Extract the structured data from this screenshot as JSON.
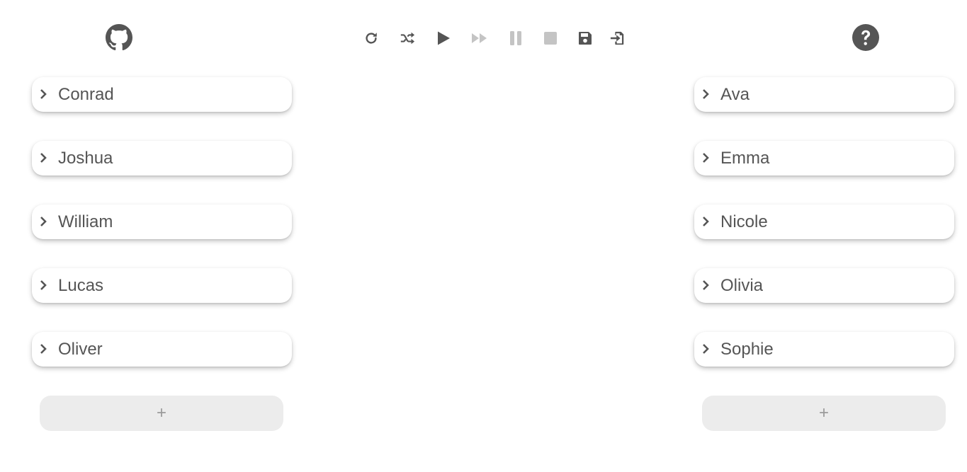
{
  "header": {
    "github_icon": "github-icon",
    "help_icon": "question-circle-icon"
  },
  "toolbar": {
    "buttons": [
      {
        "icon": "redo-icon",
        "state": "enabled"
      },
      {
        "icon": "shuffle-icon",
        "state": "enabled"
      },
      {
        "icon": "play-icon",
        "state": "enabled"
      },
      {
        "icon": "fast-forward-icon",
        "state": "disabled"
      },
      {
        "icon": "pause-icon",
        "state": "disabled"
      },
      {
        "icon": "stop-icon",
        "state": "disabled"
      },
      {
        "icon": "save-icon",
        "state": "enabled"
      },
      {
        "icon": "import-icon",
        "state": "enabled"
      }
    ]
  },
  "left_list": {
    "items": [
      {
        "label": "Conrad"
      },
      {
        "label": "Joshua"
      },
      {
        "label": "William"
      },
      {
        "label": "Lucas"
      },
      {
        "label": "Oliver"
      }
    ],
    "add_label": "+"
  },
  "right_list": {
    "items": [
      {
        "label": "Ava"
      },
      {
        "label": "Emma"
      },
      {
        "label": "Nicole"
      },
      {
        "label": "Olivia"
      },
      {
        "label": "Sophie"
      }
    ],
    "add_label": "+"
  },
  "colors": {
    "icon_enabled": "#555555",
    "icon_disabled": "#c4c4c4",
    "text": "#555555",
    "add_button_bg": "#ececec",
    "add_button_text": "#9a9a9a"
  }
}
